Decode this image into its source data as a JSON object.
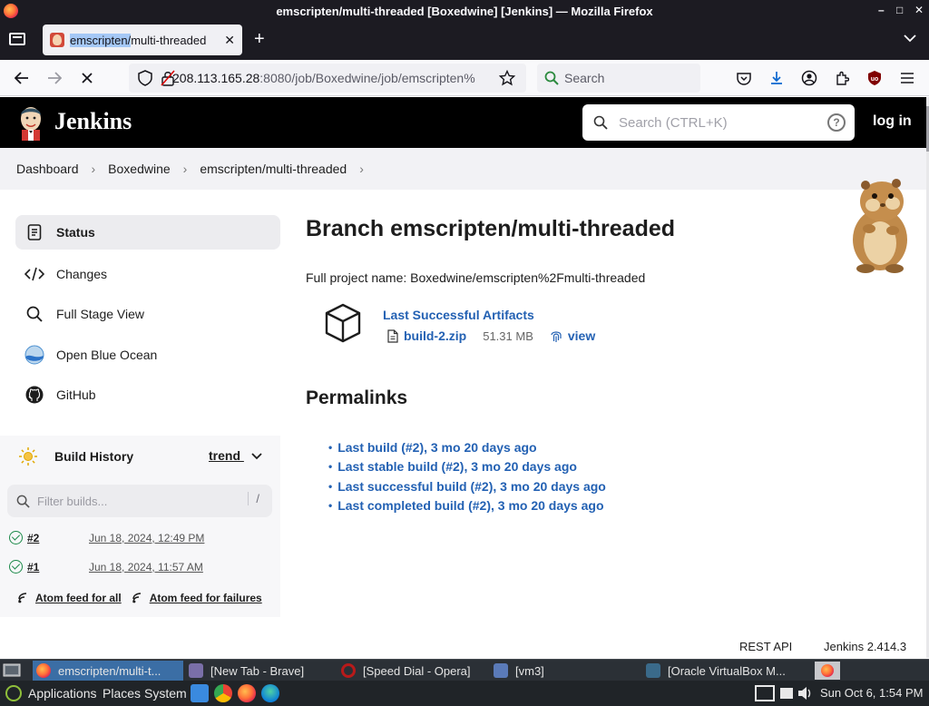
{
  "window": {
    "title": "emscripten/multi-threaded [Boxedwine] [Jenkins] — Mozilla Firefox",
    "controls": [
      "–",
      "□",
      "✕"
    ]
  },
  "browser": {
    "tab_title_hl": "emscripten/",
    "tab_title_rest": "multi-threaded",
    "url_host": "208.113.165.28",
    "url_rest": ":8080/job/Boxedwine/job/emscripten%",
    "search_placeholder": "Search"
  },
  "jenkins": {
    "brand": "Jenkins",
    "search_placeholder": "Search (CTRL+K)",
    "help": "?",
    "login": "log in",
    "version": "Jenkins 2.414.3",
    "rest_api": "REST API"
  },
  "breadcrumb": [
    "Dashboard",
    "Boxedwine",
    "emscripten/multi-threaded"
  ],
  "sidebar": {
    "items": [
      {
        "label": "Status",
        "icon": "status-icon"
      },
      {
        "label": "Changes",
        "icon": "code-icon"
      },
      {
        "label": "Full Stage View",
        "icon": "search-icon"
      },
      {
        "label": "Open Blue Ocean",
        "icon": "blue-ocean-icon"
      },
      {
        "label": "GitHub",
        "icon": "github-icon"
      }
    ]
  },
  "build_history": {
    "title": "Build History",
    "trend": "trend",
    "filter_placeholder": "Filter builds...",
    "filter_shortcut": "/",
    "builds": [
      {
        "number": "#2",
        "date": "Jun 18, 2024, 12:49 PM"
      },
      {
        "number": "#1",
        "date": "Jun 18, 2024, 11:57 AM"
      }
    ],
    "feeds": [
      "Atom feed for all",
      "Atom feed for failures"
    ]
  },
  "main": {
    "title": "Branch emscripten/multi-threaded",
    "full_name": "Full project name: Boxedwine/emscripten%2Fmulti-threaded",
    "artifacts_title": "Last Successful Artifacts",
    "artifact_file": "build-2.zip",
    "artifact_size": "51.31 MB",
    "artifact_view": "view",
    "permalinks_title": "Permalinks",
    "permalinks": [
      "Last build (#2), 3 mo 20 days ago",
      "Last stable build (#2), 3 mo 20 days ago",
      "Last successful build (#2), 3 mo 20 days ago",
      "Last completed build (#2), 3 mo 20 days ago"
    ]
  },
  "taskbar": {
    "windows": [
      "emscripten/multi-t...",
      "[New Tab - Brave]",
      "[Speed Dial - Opera]",
      "[vm3]",
      "[Oracle VirtualBox M..."
    ],
    "menus": [
      "Applications",
      "Places",
      "System"
    ],
    "clock": "Sun Oct  6,  1:54 PM"
  },
  "colors": {
    "link": "#2361b3",
    "jenkins_header": "#000000",
    "success": "#1c8a4a"
  }
}
